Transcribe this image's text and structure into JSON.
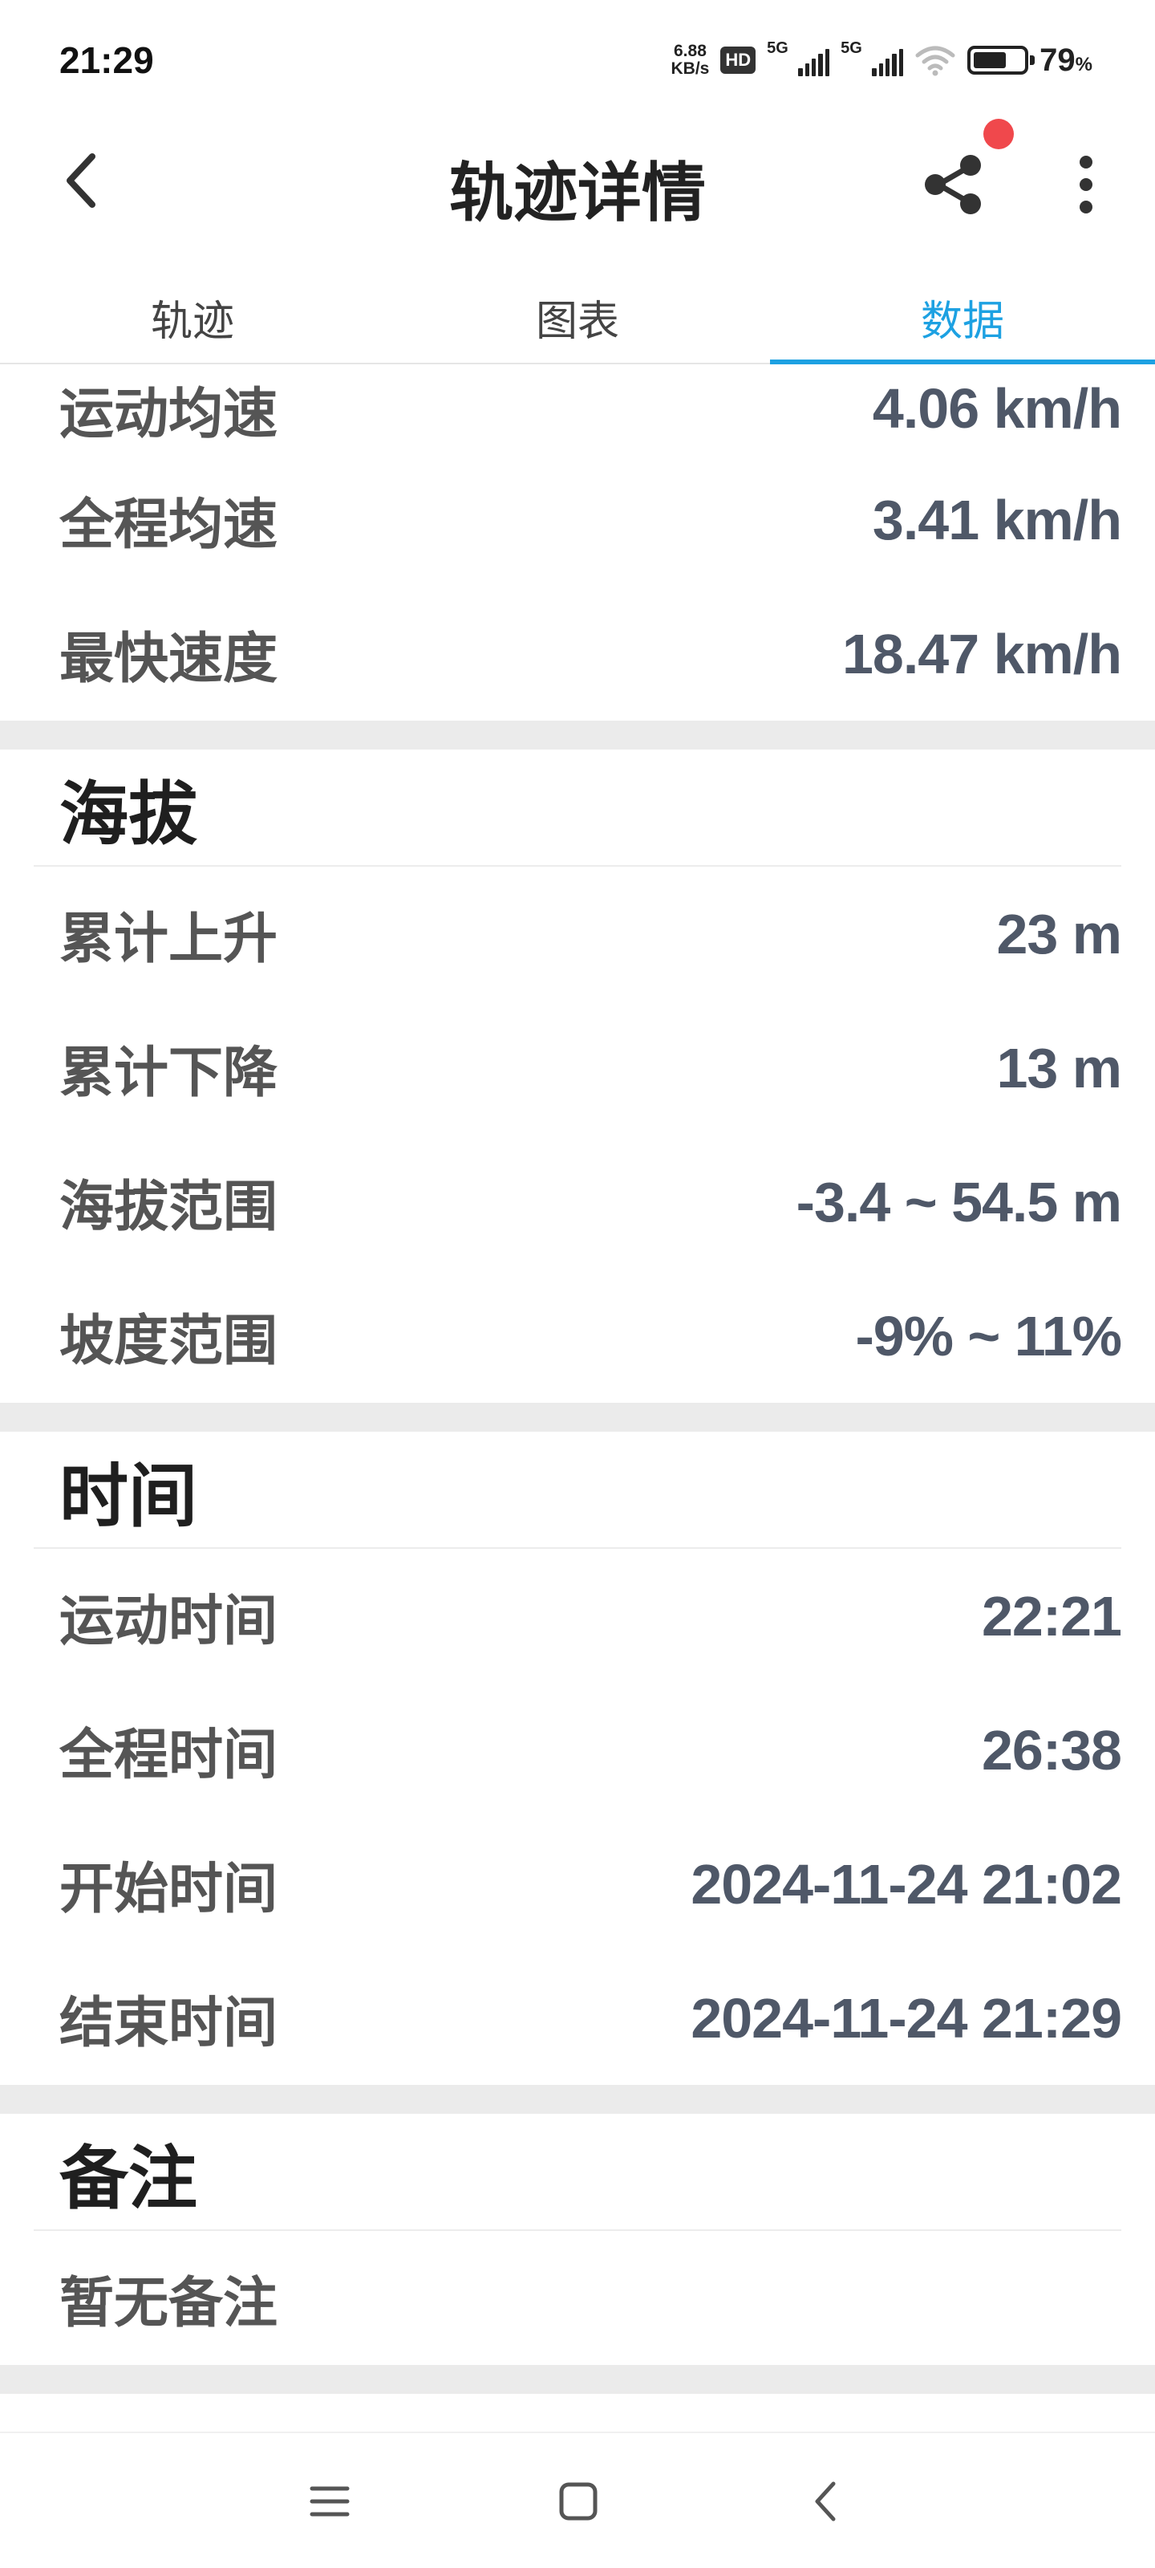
{
  "status_bar": {
    "time": "21:29",
    "net_speed_value": "6.88",
    "net_speed_unit": "KB/s",
    "hd_badge": "HD",
    "signal1_label": "5G",
    "signal2_label": "5G",
    "battery_percent": "79",
    "battery_unit": "%"
  },
  "app_bar": {
    "title": "轨迹详情",
    "back_icon": "chevron-left-icon",
    "share_icon": "share-icon",
    "more_icon": "more-vertical-icon",
    "notification_dot_color": "#f0484c"
  },
  "tabs": [
    {
      "label": "轨迹",
      "active": false
    },
    {
      "label": "图表",
      "active": false
    },
    {
      "label": "数据",
      "active": true
    }
  ],
  "accent_color": "#1da1e2",
  "speed_section": {
    "rows": [
      {
        "label": "运动均速",
        "value": "4.06 km/h"
      },
      {
        "label": "全程均速",
        "value": "3.41 km/h"
      },
      {
        "label": "最快速度",
        "value": "18.47 km/h"
      }
    ]
  },
  "altitude_section": {
    "title": "海拔",
    "rows": [
      {
        "label": "累计上升",
        "value": "23 m"
      },
      {
        "label": "累计下降",
        "value": "13 m"
      },
      {
        "label": "海拔范围",
        "value": "-3.4 ~ 54.5 m"
      },
      {
        "label": "坡度范围",
        "value": "-9% ~ 11%"
      }
    ]
  },
  "time_section": {
    "title": "时间",
    "rows": [
      {
        "label": "运动时间",
        "value": "22:21"
      },
      {
        "label": "全程时间",
        "value": "26:38"
      },
      {
        "label": "开始时间",
        "value": "2024-11-24 21:02"
      },
      {
        "label": "结束时间",
        "value": "2024-11-24 21:29"
      }
    ]
  },
  "notes_section": {
    "title": "备注",
    "text": "暂无备注"
  },
  "nav_bar": {
    "menu_icon": "menu-icon",
    "home_icon": "home-square-icon",
    "back_icon": "back-chevron-icon"
  }
}
